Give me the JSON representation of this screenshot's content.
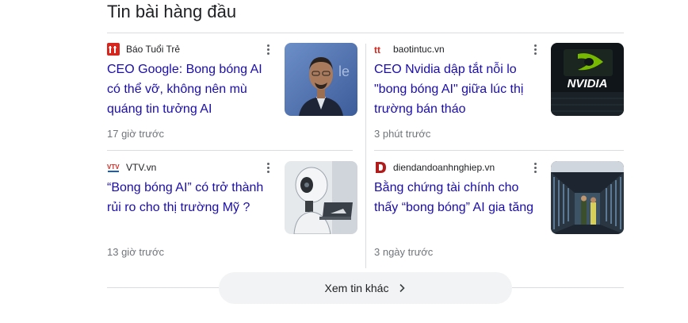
{
  "section": {
    "title": "Tin bài hàng đầu"
  },
  "articles": [
    {
      "source": "Báo Tuổi Trẻ",
      "headline": "CEO Google: Bong bóng AI có thể vỡ, không nên mù quáng tin tưởng AI",
      "time": "17 giờ trước",
      "logo_color": "#d7261e",
      "logo": "tuoitre-logo-icon",
      "thumbnail": "sundar-pichai-photo"
    },
    {
      "source": "baotintuc.vn",
      "headline": "CEO Nvidia dập tắt nỗi lo \"bong bóng AI\" giữa lúc thị trường bán tháo",
      "time": "3 phút trước",
      "logo_color": "#d7261e",
      "logo": "baotintuc-logo-icon",
      "thumbnail": "nvidia-logo-photo"
    },
    {
      "source": "VTV.vn",
      "headline": "“Bong bóng AI” có trở thành rủi ro cho thị trường Mỹ ?",
      "time": "13 giờ trước",
      "logo_color": "#d7261e",
      "logo": "vtv-logo-icon",
      "thumbnail": "robot-laptop-photo"
    },
    {
      "source": "diendandoanhnghiep.vn",
      "headline": "Bằng chứng tài chính cho thấy “bong bóng” AI gia tăng",
      "time": "3 ngày trước",
      "logo_color": "#b01c1c",
      "logo": "ddn-logo-icon",
      "thumbnail": "data-center-photo"
    }
  ],
  "more_button": {
    "label": "Xem tin khác"
  },
  "colors": {
    "link": "#1a0dab",
    "meta": "#70757a",
    "divider": "#dadce0",
    "button_bg": "#f1f3f4"
  }
}
